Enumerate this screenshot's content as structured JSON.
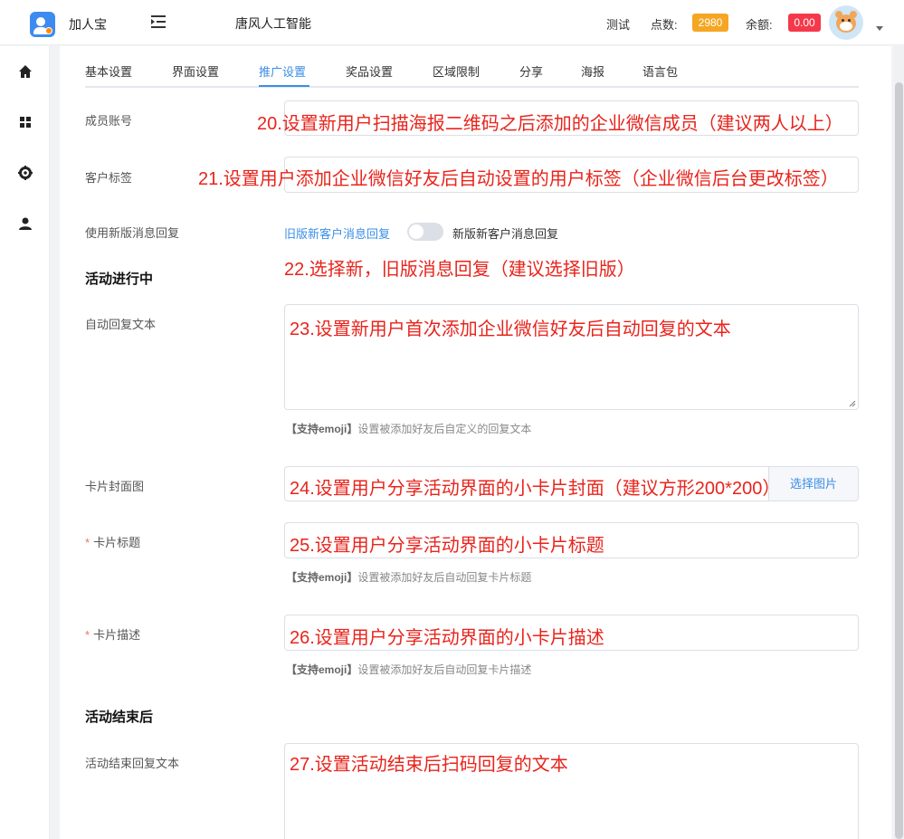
{
  "header": {
    "app_name": "加人宝",
    "org_name": "唐风人工智能",
    "user_name": "测试",
    "points_label": "点数:",
    "points_value": "2980",
    "balance_label": "余额:",
    "balance_value": "0.00"
  },
  "sidebar": {
    "items": [
      {
        "icon": "home-icon"
      },
      {
        "icon": "grid-icon"
      },
      {
        "icon": "gear-icon"
      },
      {
        "icon": "user-icon"
      }
    ]
  },
  "tabs": [
    {
      "label": "基本设置"
    },
    {
      "label": "界面设置"
    },
    {
      "label": "推广设置",
      "active": true
    },
    {
      "label": "奖品设置"
    },
    {
      "label": "区域限制"
    },
    {
      "label": "分享"
    },
    {
      "label": "海报"
    },
    {
      "label": "语言包"
    }
  ],
  "form": {
    "member_account": {
      "label": "成员账号",
      "annotation": "20.设置新用户扫描海报二维码之后添加的企业微信成员（建议两人以上）"
    },
    "customer_tag": {
      "label": "客户标签",
      "annotation": "21.设置用户添加企业微信好友后自动设置的用户标签（企业微信后台更改标签）"
    },
    "new_msg_reply": {
      "label": "使用新版消息回复",
      "option_old": "旧版新客户消息回复",
      "option_new": "新版新客户消息回复",
      "annotation": "22.选择新，旧版消息回复（建议选择旧版）"
    },
    "section_active": "活动进行中",
    "auto_reply": {
      "label": "自动回复文本",
      "value": "23.设置新用户首次添加企业微信好友后自动回复的文本",
      "hint_bold": "【支持emoji】",
      "hint": "设置被添加好友后自定义的回复文本"
    },
    "card_cover": {
      "label": "卡片封面图",
      "value": "24.设置用户分享活动界面的小卡片封面（建议方形200*200）",
      "button": "选择图片"
    },
    "card_title": {
      "label": "卡片标题",
      "required": "*",
      "value": "25.设置用户分享活动界面的小卡片标题",
      "hint_bold": "【支持emoji】",
      "hint": "设置被添加好友后自动回复卡片标题"
    },
    "card_desc": {
      "label": "卡片描述",
      "required": "*",
      "value": "26.设置用户分享活动界面的小卡片描述",
      "hint_bold": "【支持emoji】",
      "hint": "设置被添加好友后自动回复卡片描述"
    },
    "section_ended": "活动结束后",
    "end_reply": {
      "label": "活动结束回复文本",
      "value": "27.设置活动结束后扫码回复的文本"
    }
  },
  "colors": {
    "accent": "#3a8ee6",
    "annotation": "#e8241c",
    "points_badge": "#f5a623",
    "balance_badge": "#f5394a"
  }
}
